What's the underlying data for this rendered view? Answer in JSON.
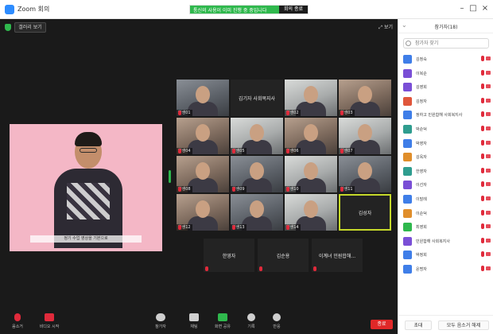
{
  "window": {
    "app_title": "Zoom 회의",
    "banner_text": "통신의 사용이 이미 진행 중 중입니다",
    "banner_button": "회의 종료",
    "min_glyph": "–",
    "max_glyph": "□",
    "close_glyph": "×"
  },
  "meeting": {
    "view_label": "갤러리 보기",
    "fullscreen_label": "⤢ 보기",
    "speaker_caption": "정기 수업 영상을 기본으로",
    "tiles": [
      {
        "name": "학생01",
        "kind": "video",
        "tone": "",
        "muted": true
      },
      {
        "name": "김기자 사회복지사",
        "kind": "name",
        "tone": "",
        "muted": false
      },
      {
        "name": "학생02",
        "kind": "video",
        "tone": "light",
        "muted": true
      },
      {
        "name": "학생03",
        "kind": "video",
        "tone": "warm",
        "muted": true
      },
      {
        "name": "학생04",
        "kind": "video",
        "tone": "warm",
        "muted": true
      },
      {
        "name": "학생05",
        "kind": "video",
        "tone": "light",
        "muted": true
      },
      {
        "name": "학생06",
        "kind": "video",
        "tone": "warm",
        "muted": true
      },
      {
        "name": "학생07",
        "kind": "video",
        "tone": "light",
        "muted": true
      },
      {
        "name": "학생08",
        "kind": "video",
        "tone": "warm",
        "muted": true
      },
      {
        "name": "학생09",
        "kind": "video",
        "tone": "",
        "muted": true
      },
      {
        "name": "학생10",
        "kind": "video",
        "tone": "light",
        "muted": true
      },
      {
        "name": "학생11",
        "kind": "video",
        "tone": "",
        "muted": true
      },
      {
        "name": "학생12",
        "kind": "video",
        "tone": "warm",
        "muted": true
      },
      {
        "name": "학생13",
        "kind": "video",
        "tone": "",
        "muted": true
      },
      {
        "name": "학생14",
        "kind": "video",
        "tone": "light",
        "muted": true
      },
      {
        "name": "김성자",
        "kind": "name",
        "tone": "",
        "muted": false,
        "active": true
      }
    ],
    "bottom_tiles": [
      {
        "name": "한영자",
        "muted": true
      },
      {
        "name": "김순용",
        "muted": true
      },
      {
        "name": "이계녀 민원합해...",
        "muted": true
      }
    ]
  },
  "toolbar": {
    "mute": "음소거",
    "video": "비디오 시작",
    "participants": "참가자",
    "chat": "채팅",
    "share": "화면 공유",
    "record": "기록",
    "reactions": "반응",
    "end": "종료"
  },
  "panel": {
    "title": "참가자(18)",
    "search_placeholder": "참가자 찾기",
    "participants": [
      {
        "name": "김정숙",
        "color": "#3f7ee8",
        "mic_off": true
      },
      {
        "name": "이복순",
        "color": "#7a4fd6",
        "mic_off": true
      },
      {
        "name": "김영희",
        "color": "#7a4fd6",
        "mic_off": true
      },
      {
        "name": "김정자",
        "color": "#e0563b",
        "mic_off": true
      },
      {
        "name": "정하고 민원합해 사회복지사",
        "color": "#3f7ee8",
        "mic_off": true
      },
      {
        "name": "박순덕",
        "color": "#2f9d8f",
        "mic_off": true
      },
      {
        "name": "박영자",
        "color": "#3f7ee8",
        "mic_off": true
      },
      {
        "name": "김옥자",
        "color": "#e08e2b",
        "mic_off": true
      },
      {
        "name": "한영자",
        "color": "#2f9d8f",
        "mic_off": true
      },
      {
        "name": "이선자",
        "color": "#7a4fd6",
        "mic_off": true
      },
      {
        "name": "이말례",
        "color": "#3f7ee8",
        "mic_off": true
      },
      {
        "name": "이순덕",
        "color": "#e08e2b",
        "mic_off": true
      },
      {
        "name": "최영희",
        "color": "#2fb84d",
        "mic_off": true
      },
      {
        "name": "민원합해 사회복지사",
        "color": "#7a4fd6",
        "mic_off": true
      },
      {
        "name": "박정희",
        "color": "#3f7ee8",
        "mic_off": true
      },
      {
        "name": "윤명자",
        "color": "#3f7ee8",
        "mic_off": true
      }
    ],
    "invite_label": "초대",
    "mute_all_label": "모두 음소거 해제"
  }
}
